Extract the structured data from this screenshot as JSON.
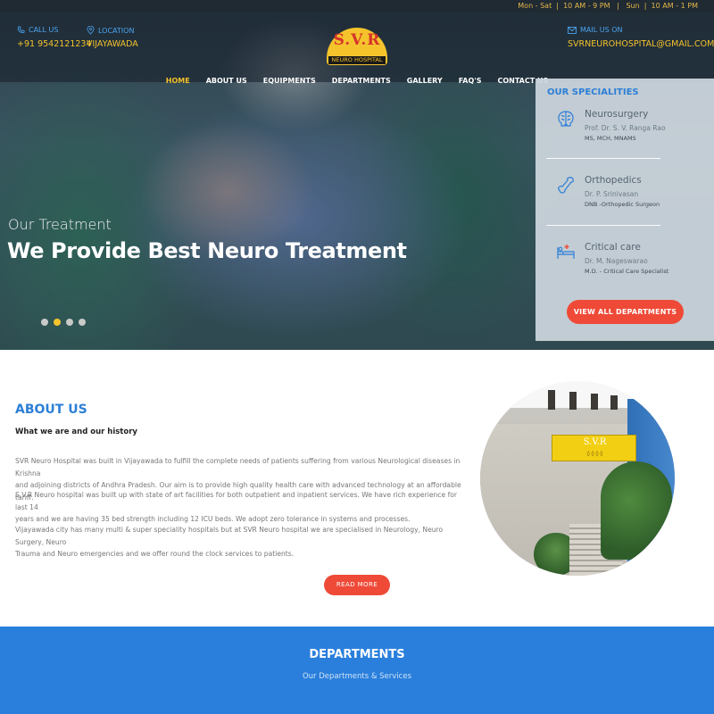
{
  "topbar": {
    "hours": "Mon - Sat  |  10 AM - 9 PM   |   Sun  |  10 AM - 1 PM"
  },
  "header": {
    "call_label": "CALL US",
    "phone": "+91 9542121234",
    "location_label": "LOCATION",
    "location": "VIJAYAWADA",
    "mail_label": "MAIL US ON",
    "email": "SVRNEUROHOSPITAL@GMAIL.COM",
    "logo_text": "S.V.R",
    "logo_band": "NEURO HOSPITAL"
  },
  "nav": {
    "items": [
      {
        "label": "HOME",
        "active": true
      },
      {
        "label": "ABOUT US"
      },
      {
        "label": "EQUIPMENTS"
      },
      {
        "label": "DEPARTMENTS"
      },
      {
        "label": "GALLERY"
      },
      {
        "label": "FAQ'S"
      },
      {
        "label": "CONTACT US"
      }
    ]
  },
  "hero": {
    "subtitle": "Our Treatment",
    "title": "We Provide Best Neuro Treatment",
    "slides": 4,
    "active_slide": 2
  },
  "specialities": {
    "title": "OUR SPECIALITIES",
    "items": [
      {
        "name": "Neurosurgery",
        "doctor": "Prof. Dr. S. V. Ranga Rao",
        "degree": "MS, MCH, MNAMS",
        "icon": "brain-icon"
      },
      {
        "name": "Orthopedics",
        "doctor": "Dr. P. Srinivasan",
        "degree": "DNB -Orthopedic Surgeon",
        "icon": "bone-icon"
      },
      {
        "name": "Critical care",
        "doctor": "Dr. M. Nageswarao",
        "degree": "M.D. - Critical Care Specialist",
        "icon": "hospital-bed-icon"
      }
    ],
    "button": "VIEW ALL DEPARTMENTS"
  },
  "about": {
    "title": "ABOUT US",
    "subtitle": "What we are and our history",
    "p1_l1": "SVR Neuro Hospital was built in Vijayawada to fulfill the complete needs of patients suffering from various Neurological diseases in Krishna",
    "p1_l2": "and adjoining districts of Andhra Pradesh. Our aim is to provide high quality health care with advanced technology at an affordable tariff.",
    "p2_l1": "S.V.R Neuro hospital was built up with state of art facilities for both outpatient and inpatient services. We have rich experience for last 14",
    "p2_l2": "years and we are having 35 bed strength including 12 ICU beds. We adopt zero tolerance in systems and processes.",
    "p3_l1": "Vijayawada city has many multi & super speciality hospitals but at SVR Neuro hospital we are specialised in Neurology, Neuro Surgery, Neuro",
    "p3_l2": "Trauma and Neuro emergencies and we offer round the clock services to patients.",
    "button": "READ MORE",
    "photo_sign": "S.V.R"
  },
  "departments": {
    "title": "DEPARTMENTS",
    "subtitle": "Our Departments & Services"
  },
  "colors": {
    "accent_blue": "#2a7fdc",
    "accent_yellow": "#f5c32c",
    "accent_red": "#ef4a37"
  }
}
